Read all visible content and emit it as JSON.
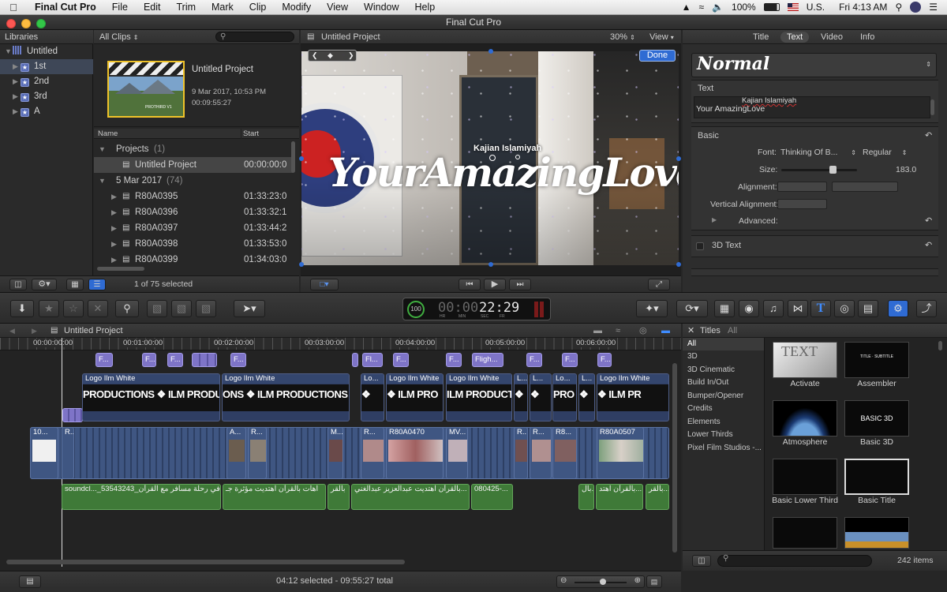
{
  "menubar": {
    "app": "Final Cut Pro",
    "items": [
      "File",
      "Edit",
      "Trim",
      "Mark",
      "Clip",
      "Modify",
      "View",
      "Window",
      "Help"
    ],
    "battery": "100%",
    "locale": "U.S.",
    "clock": "Fri 4:13 AM"
  },
  "window_title": "Final Cut Pro",
  "libraries": {
    "header": "Libraries",
    "items": [
      {
        "label": "Untitled"
      },
      {
        "label": "1st"
      },
      {
        "label": "2nd"
      },
      {
        "label": "3rd"
      },
      {
        "label": "A"
      }
    ]
  },
  "browser": {
    "filter": "All Clips",
    "project_name": "Untitled Project",
    "project_date": "9 Mar 2017, 10:53 PM",
    "project_duration": "00:09:55:27",
    "thumb_label": "PROTHIRD V1",
    "col_name": "Name",
    "col_start": "Start",
    "group_projects": "Projects",
    "group_projects_count": "(1)",
    "project_row": {
      "name": "Untitled Project",
      "start": "00:00:00:0"
    },
    "group_date": "5 Mar 2017",
    "group_date_count": "(74)",
    "clips": [
      {
        "name": "R80A0395",
        "start": "01:33:23:0"
      },
      {
        "name": "R80A0396",
        "start": "01:33:32:1"
      },
      {
        "name": "R80A0397",
        "start": "01:33:44:2"
      },
      {
        "name": "R80A0398",
        "start": "01:33:53:0"
      },
      {
        "name": "R80A0399",
        "start": "01:34:03:0"
      }
    ],
    "selection_status": "1 of 75 selected"
  },
  "viewer": {
    "title": "Untitled Project",
    "zoom": "30%",
    "view_menu": "View",
    "done": "Done",
    "overlay_small": "Kajian Islamiyah",
    "overlay_big": "YourAmazingLove"
  },
  "inspector": {
    "tabs": [
      "Title",
      "Text",
      "Video",
      "Info"
    ],
    "active_tab": "Text",
    "preset": "Normal",
    "text_label": "Text",
    "text_line1": "Kajian Islamiyah",
    "text_line2": "Your AmazingLove",
    "basic_label": "Basic",
    "font_label": "Font:",
    "font_value": "Thinking Of B...",
    "font_style": "Regular",
    "size_label": "Size:",
    "size_value": "183.0",
    "size_level": 0.68,
    "alignment_label": "Alignment:",
    "valign_label": "Vertical Alignment:",
    "advanced_label": "Advanced:",
    "text3d_label": "3D Text"
  },
  "toolbar": {
    "timecode_pct": "100",
    "timecode_main": "00:00",
    "timecode_bright": "22:29",
    "tc_units": [
      "HR",
      "MIN",
      "SEC",
      "FR"
    ]
  },
  "timeline": {
    "project": "Untitled Project",
    "ruler": [
      "00:00:00:00",
      "00:01:00:00",
      "00:02:00:00",
      "00:03:00:00",
      "00:04:00:00",
      "00:05:00:00",
      "00:06:00:00"
    ],
    "title_clips": [
      "F...",
      "F...",
      "F...",
      "F...",
      "Fl...",
      "F...",
      "Fligh...",
      "F...",
      "F...",
      "F..."
    ],
    "logo_label": "Logo Ilm White",
    "logo_short": "Lo...",
    "logo_text": "PRODUCTIONS",
    "video_labels": [
      "10...",
      "R...",
      "A...",
      "R...",
      "M...",
      "R...",
      "R80A0470",
      "MV...",
      "R...",
      "R...",
      "R8...",
      "R80A0507"
    ],
    "audio_labels": [
      "soundcl..._53543243_في رحلة مسافر مع القرآن",
      "اهات بالقرآن اهتديت مؤثرة جـ",
      "بالقر",
      "بالقرآن اهتديت عبدالعزيز عبدالغني...",
      "080425-...",
      "بال...",
      "بالقرآن اهتد...",
      "بالقر..."
    ],
    "status": "04:12 selected - 09:55:27 total"
  },
  "titles_browser": {
    "header": "Titles",
    "header_all": "All",
    "categories": [
      "All",
      "3D",
      "3D Cinematic",
      "Build In/Out",
      "Bumper/Opener",
      "Credits",
      "Elements",
      "Lower Thirds",
      "Pixel Film Studios -..."
    ],
    "tiles": [
      "Activate",
      "Assembler",
      "Atmosphere",
      "Basic 3D",
      "Basic Lower Third",
      "Basic Title"
    ],
    "count": "242 items"
  }
}
